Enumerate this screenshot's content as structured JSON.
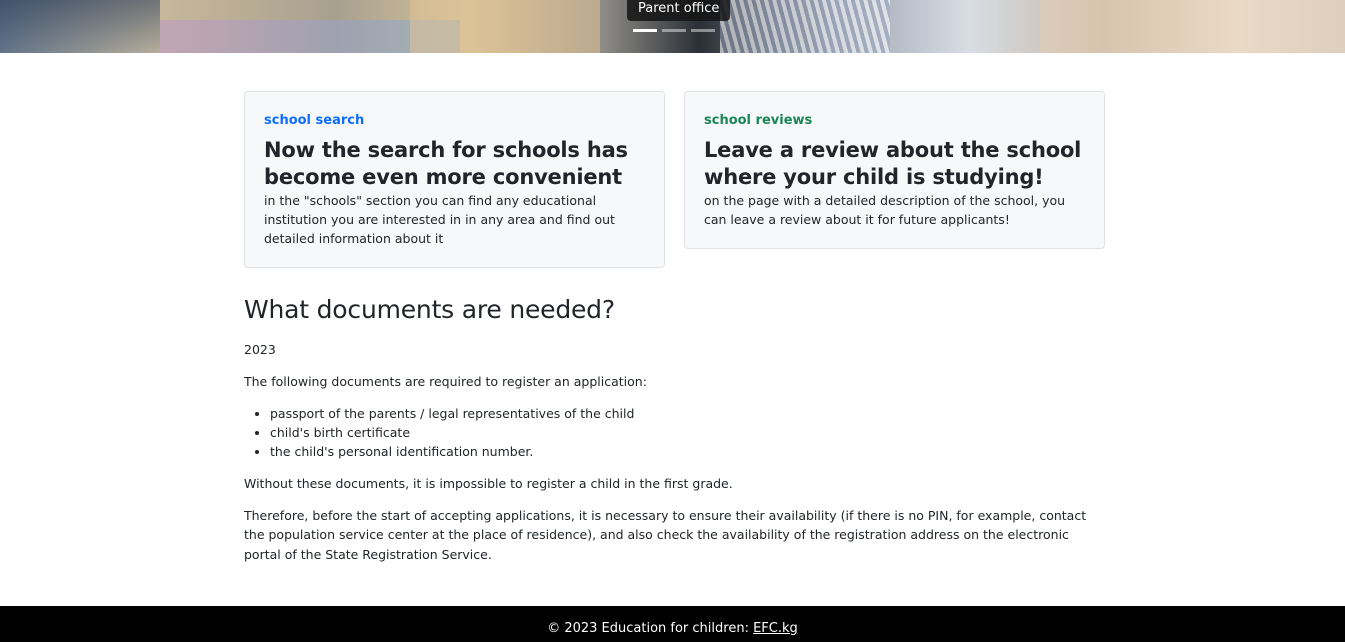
{
  "hero": {
    "caption": "Parent office",
    "slides": 3,
    "active_slide": 1
  },
  "cards": [
    {
      "tag": "school search",
      "tag_color": "#0d6efd",
      "title": "Now the search for schools has become even more convenient",
      "text": "in the \"schools\" section you can find any educational institution you are interested in in any area and find out detailed information about it"
    },
    {
      "tag": "school reviews",
      "tag_color": "#198754",
      "title": "Leave a review about the school where your child is studying!",
      "text": "on the page with a detailed description of the school, you can leave a review about it for future applicants!"
    }
  ],
  "article": {
    "heading": "What documents are needed?",
    "year": "2023",
    "intro": "The following documents are required to register an application:",
    "items": [
      "passport of the parents / legal representatives of the child",
      "child's birth certificate",
      "the child's personal identification number."
    ],
    "paragraph1": "Without these documents, it is impossible to register a child in the first grade.",
    "paragraph2": "Therefore, before the start of accepting applications, it is necessary to ensure their availability (if there is no PIN, for example, contact the population service center at the place of residence), and also check the availability of the registration address on the electronic portal of the State Registration Service."
  },
  "footer": {
    "text": "© 2023 Education for children: ",
    "link": "EFC.kg"
  }
}
